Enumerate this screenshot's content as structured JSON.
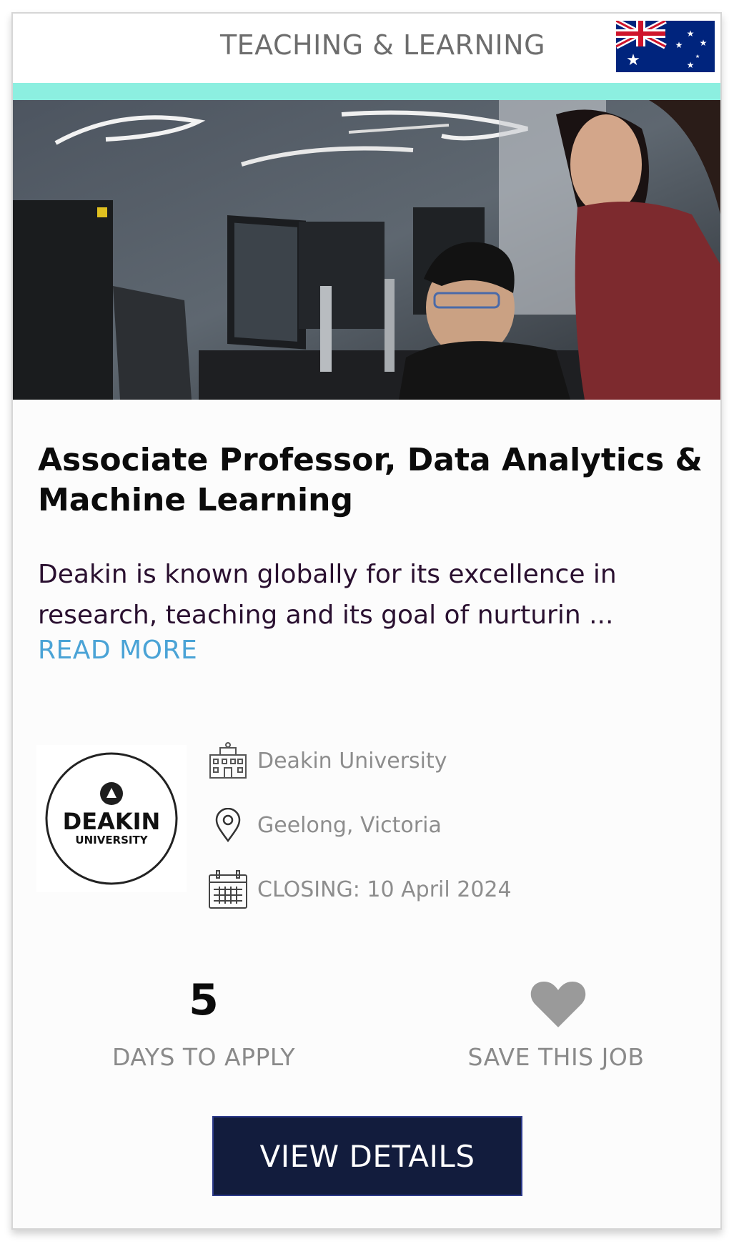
{
  "card": {
    "category": "TEACHING & LEARNING",
    "country_flag_icon": "australia-flag-icon",
    "accent_color": "#8cefe0",
    "job_title": "Associate Professor, Data Analytics & Machine Learning",
    "description": "Deakin is known globally for its excellence in research, teaching and its goal of nurturin ...",
    "read_more_label": "READ MORE",
    "employer_logo": {
      "line1": "DEAKIN",
      "line2": "UNIVERSITY"
    },
    "employer": "Deakin University",
    "employer_icon": "building-icon",
    "location": "Geelong, Victoria",
    "location_icon": "map-pin-icon",
    "closing": "CLOSING: 10 April 2024",
    "closing_icon": "calendar-icon",
    "days_to_apply_value": "5",
    "days_to_apply_label": "DAYS TO APPLY",
    "save_label": "SAVE THIS JOB",
    "save_icon": "heart-icon",
    "view_details_label": "VIEW DETAILS",
    "button_color": "#121c3d",
    "link_color": "#4aa3d6"
  }
}
